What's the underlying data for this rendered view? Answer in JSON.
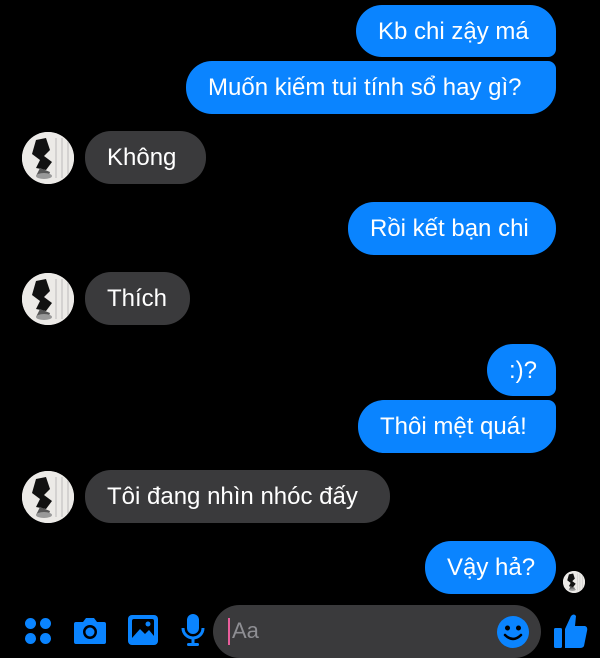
{
  "conversation": {
    "messages": [
      {
        "sender": "me",
        "text": "Kb chi zậy má"
      },
      {
        "sender": "me",
        "text": "Muốn kiếm tui tính sổ hay gì?"
      },
      {
        "sender": "other",
        "text": "Không"
      },
      {
        "sender": "me",
        "text": "Rồi kết bạn chi"
      },
      {
        "sender": "other",
        "text": "Thích"
      },
      {
        "sender": "me",
        "text": ":)?"
      },
      {
        "sender": "me",
        "text": "Thôi mệt quá!"
      },
      {
        "sender": "other",
        "text": "Tôi đang nhìn nhóc đấy"
      },
      {
        "sender": "me",
        "text": "Vậy hả?"
      }
    ]
  },
  "composer": {
    "placeholder": "Aa",
    "icons": [
      "menu-dots-icon",
      "camera-icon",
      "image-icon",
      "mic-icon",
      "emoji-icon",
      "thumbs-up-icon"
    ]
  },
  "colors": {
    "outgoing_bubble": "#0a84ff",
    "incoming_bubble": "#3a3a3c",
    "accent": "#0a84ff",
    "background": "#000000"
  }
}
